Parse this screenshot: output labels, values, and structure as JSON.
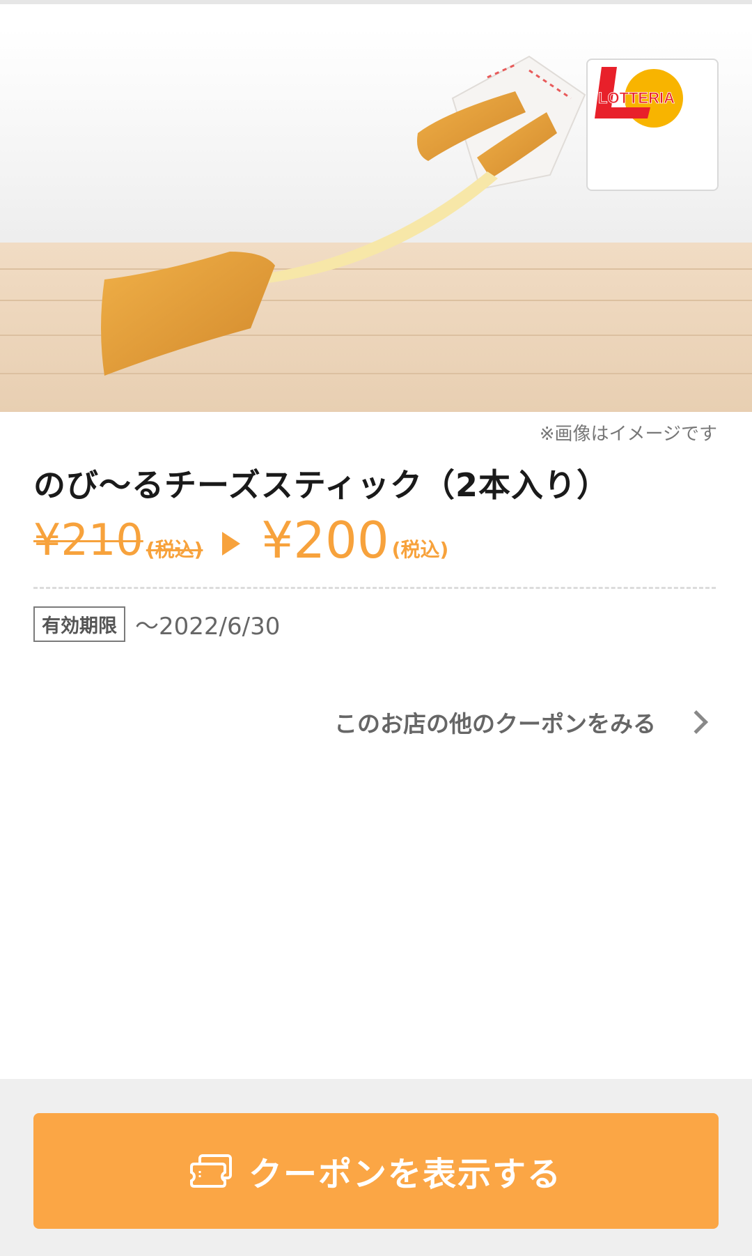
{
  "hero": {
    "image_note": "※画像はイメージです",
    "brand_logo_text": "LOTTERIA"
  },
  "product": {
    "title": "のび〜るチーズスティック（2本入り）",
    "price_old": "¥210",
    "price_old_tax": "(税込)",
    "price_new": "¥200",
    "price_new_tax": "(税込)"
  },
  "expiry": {
    "label": "有効期限",
    "date": "〜2022/6/30"
  },
  "links": {
    "more_coupons": "このお店の他のクーポンをみる"
  },
  "actions": {
    "show_coupon": "クーポンを表示する"
  },
  "colors": {
    "accent": "#fba645",
    "price": "#f7a23c",
    "brand_red": "#e8202a",
    "brand_yellow": "#f8b400"
  },
  "icons": {
    "arrow": "triangle-right-icon",
    "chevron": "chevron-right-icon",
    "ticket": "ticket-icon"
  }
}
